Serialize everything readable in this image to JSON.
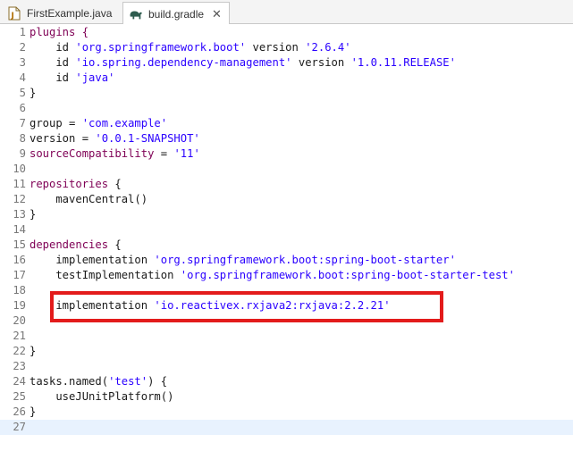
{
  "tabs": [
    {
      "label": "FirstExample.java",
      "icon": "java-file-icon"
    },
    {
      "label": "build.gradle",
      "icon": "gradle-elephant-icon",
      "close": "✕"
    }
  ],
  "lines": [
    {
      "n": "1",
      "parts": [
        {
          "t": "plugins {",
          "c": "kw"
        }
      ]
    },
    {
      "n": "2",
      "parts": [
        {
          "t": "    id "
        },
        {
          "t": "'org.springframework.boot'",
          "c": "str"
        },
        {
          "t": " version "
        },
        {
          "t": "'2.6.4'",
          "c": "str"
        }
      ]
    },
    {
      "n": "3",
      "parts": [
        {
          "t": "    id "
        },
        {
          "t": "'io.spring.dependency-management'",
          "c": "str"
        },
        {
          "t": " version "
        },
        {
          "t": "'1.0.11.RELEASE'",
          "c": "str"
        }
      ]
    },
    {
      "n": "4",
      "parts": [
        {
          "t": "    id "
        },
        {
          "t": "'java'",
          "c": "str"
        }
      ]
    },
    {
      "n": "5",
      "parts": [
        {
          "t": "}"
        }
      ]
    },
    {
      "n": "6",
      "parts": []
    },
    {
      "n": "7",
      "parts": [
        {
          "t": "group = "
        },
        {
          "t": "'com.example'",
          "c": "str"
        }
      ]
    },
    {
      "n": "8",
      "parts": [
        {
          "t": "version = "
        },
        {
          "t": "'0.0.1-SNAPSHOT'",
          "c": "str"
        }
      ]
    },
    {
      "n": "9",
      "parts": [
        {
          "t": "sourceCompatibility",
          "c": "kw"
        },
        {
          "t": " = "
        },
        {
          "t": "'11'",
          "c": "str"
        }
      ]
    },
    {
      "n": "10",
      "parts": []
    },
    {
      "n": "11",
      "parts": [
        {
          "t": "repositories",
          "c": "kw"
        },
        {
          "t": " {"
        }
      ]
    },
    {
      "n": "12",
      "parts": [
        {
          "t": "    mavenCentral()"
        }
      ]
    },
    {
      "n": "13",
      "parts": [
        {
          "t": "}"
        }
      ]
    },
    {
      "n": "14",
      "parts": []
    },
    {
      "n": "15",
      "parts": [
        {
          "t": "dependencies",
          "c": "kw"
        },
        {
          "t": " {"
        }
      ]
    },
    {
      "n": "16",
      "parts": [
        {
          "t": "    implementation "
        },
        {
          "t": "'org.springframework.boot:spring-boot-starter'",
          "c": "str"
        }
      ]
    },
    {
      "n": "17",
      "parts": [
        {
          "t": "    testImplementation "
        },
        {
          "t": "'org.springframework.boot:spring-boot-starter-test'",
          "c": "str"
        }
      ]
    },
    {
      "n": "18",
      "parts": []
    },
    {
      "n": "19",
      "parts": [
        {
          "t": "    implementation "
        },
        {
          "t": "'io.reactivex.rxjava2:rxjava:2.2.21'",
          "c": "str"
        }
      ]
    },
    {
      "n": "20",
      "parts": []
    },
    {
      "n": "21",
      "parts": []
    },
    {
      "n": "22",
      "parts": [
        {
          "t": "}"
        }
      ]
    },
    {
      "n": "23",
      "parts": []
    },
    {
      "n": "24",
      "parts": [
        {
          "t": "tasks.named("
        },
        {
          "t": "'test'",
          "c": "str"
        },
        {
          "t": ") {"
        }
      ]
    },
    {
      "n": "25",
      "parts": [
        {
          "t": "    useJUnitPlatform()"
        }
      ]
    },
    {
      "n": "26",
      "parts": [
        {
          "t": "}"
        }
      ]
    },
    {
      "n": "27",
      "parts": [],
      "current": true
    }
  ]
}
